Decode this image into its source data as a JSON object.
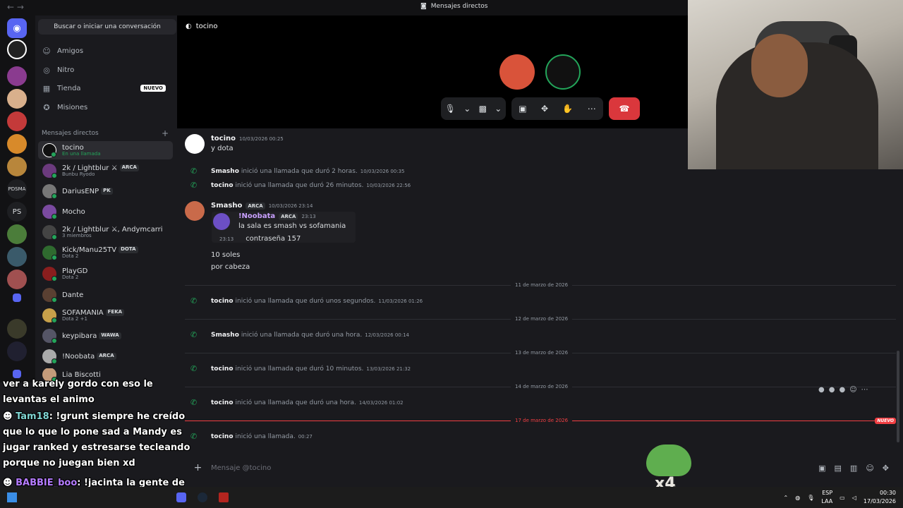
{
  "window": {
    "title": "Mensajes directos",
    "nav": "← →"
  },
  "servers": {
    "ps_label": "PS",
    "pdsm_label": "PDSMA"
  },
  "sidebar": {
    "search_label": "Buscar o iniciar una conversación",
    "nav_items": [
      {
        "label": "Amigos",
        "icon": "friends-icon"
      },
      {
        "label": "Nitro",
        "icon": "nitro-icon"
      },
      {
        "label": "Tienda",
        "icon": "shop-icon",
        "badge": "NUEVO"
      },
      {
        "label": "Misiones",
        "icon": "quests-icon"
      }
    ],
    "dm_header": "Mensajes directos",
    "dms": [
      {
        "name": "tocino",
        "sub": "En una llamada",
        "color": "#111"
      },
      {
        "name": "2k / Lightblur ⚔",
        "tag": "ARCA",
        "sub": "Bunbu Ryodo",
        "color": "#6b3a7d"
      },
      {
        "name": "DariusENP",
        "tag": "PK",
        "sub": "",
        "color": "#777"
      },
      {
        "name": "Mocho",
        "tag": "",
        "sub": "",
        "color": "#7a4aa0"
      },
      {
        "name": "2k / Lightblur ⚔, Andymcarri",
        "tag": "",
        "sub": "3 miembros",
        "color": "#444"
      },
      {
        "name": "Kick/Manu25TV",
        "tag": "DOTA",
        "sub": "Dota 2",
        "color": "#2f6a2f"
      },
      {
        "name": "PlayGD",
        "tag": "",
        "sub": "Dota 2",
        "color": "#8a1e1e"
      },
      {
        "name": "Dante",
        "tag": "",
        "sub": "",
        "color": "#5a4032"
      },
      {
        "name": "SOFAMANIA",
        "tag": "FEKA",
        "sub": "Dota 2 +1",
        "color": "#c7a04a"
      },
      {
        "name": "keypibara",
        "tag": "WAWA",
        "sub": "",
        "color": "#556"
      },
      {
        "name": "!Noobata",
        "tag": "ARCA",
        "sub": "",
        "color": "#aaa"
      },
      {
        "name": "Lia Biscotti",
        "tag": "",
        "sub": "",
        "color": "#c49b7a"
      }
    ]
  },
  "call": {
    "channel": "tocino",
    "hangup_icon": "☎"
  },
  "messages": {
    "m1": {
      "author": "tocino",
      "time": "10/03/2026 00:25",
      "text": "y dota"
    },
    "s1": {
      "author": "Smasho",
      "text": "inició una llamada que duró 2 horas.",
      "time": "10/03/2026 00:35"
    },
    "s2": {
      "author": "tocino",
      "text": "inició una llamada que duró 26 minutos.",
      "time": "10/03/2026 22:56"
    },
    "m2": {
      "author": "Smasho",
      "tag": "ARCA",
      "time": "10/03/2026 23:14",
      "reply_author": "!Noobata",
      "reply_tag": "ARCA",
      "reply_time": "23:13",
      "reply_text": "la sala es smash vs sofamania",
      "reply_time2": "23:13",
      "reply_text2": "contraseña 157",
      "line1": "10 soles",
      "line2": "por cabeza"
    },
    "d1": "11 de marzo de 2026",
    "s3": {
      "author": "tocino",
      "text": "inició una llamada que duró unos segundos.",
      "time": "11/03/2026 01:26"
    },
    "d2": "12 de marzo de 2026",
    "s4": {
      "author": "Smasho",
      "text": "inició una llamada que duró una hora.",
      "time": "12/03/2026 00:14"
    },
    "d3": "13 de marzo de 2026",
    "s5": {
      "author": "tocino",
      "text": "inició una llamada que duró 10 minutos.",
      "time": "13/03/2026 21:32"
    },
    "d4": "14 de marzo de 2026",
    "s6": {
      "author": "tocino",
      "text": "inició una llamada que duró una hora.",
      "time": "14/03/2026 01:02"
    },
    "d5": "17 de marzo de 2026",
    "new_badge": "NUEVO",
    "s7": {
      "author": "tocino",
      "text": "inició una llamada.",
      "time": "00:27"
    }
  },
  "composer": {
    "placeholder": "Mensaje @tocino"
  },
  "overlay": {
    "line0": "ver a karely gordo con eso le levantas el animo",
    "user1": "Tam18",
    "msg1": ": !grunt siempre he creído que lo que lo pone sad a Mandy es jugar ranked y estresarse tecleando porque no juegan bien xd",
    "user2": "BABBIE_boo",
    "msg2": ": !jacinta la gente de mandy se va cuando juega contigo"
  },
  "frog": {
    "label": "x4"
  },
  "taskbar": {
    "lang": "ESP",
    "region": "LAA",
    "time": "00:30",
    "date": "17/03/2026"
  }
}
